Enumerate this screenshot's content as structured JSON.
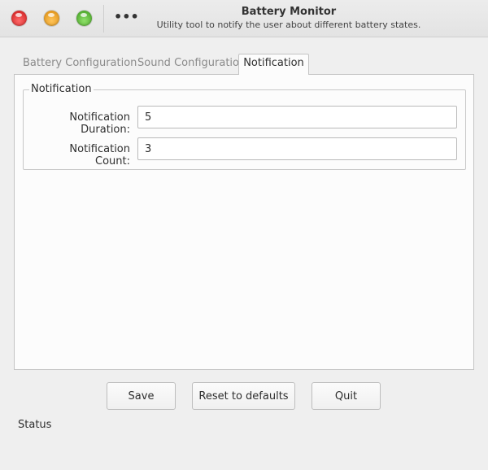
{
  "window": {
    "title": "Battery Monitor",
    "subtitle": "Utility tool to notify the user about different battery states.",
    "menu_glyph": "•••"
  },
  "tabs": [
    {
      "label": "Battery Configuration",
      "active": false
    },
    {
      "label": "Sound Configuration",
      "active": false
    },
    {
      "label": "Notification",
      "active": true
    }
  ],
  "notification": {
    "group_title": "Notification",
    "duration_label": "Notification Duration:",
    "duration_value": "5",
    "count_label": "Notification Count:",
    "count_value": "3"
  },
  "buttons": {
    "save": "Save",
    "reset": "Reset to defaults",
    "quit": "Quit"
  },
  "status": "Status",
  "colors": {
    "close": "#e32a2a",
    "minimize": "#f0a520",
    "maximize": "#5bbf34"
  }
}
